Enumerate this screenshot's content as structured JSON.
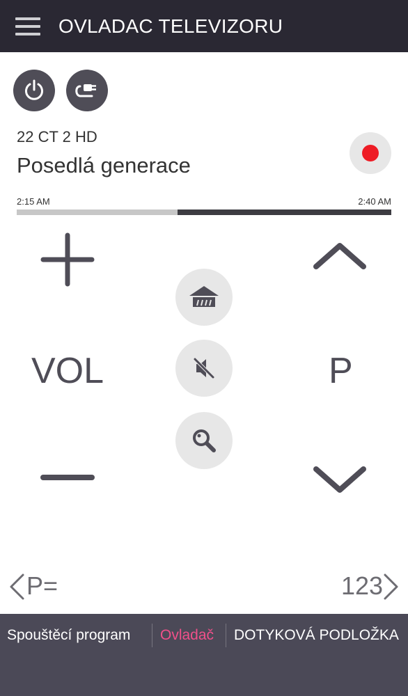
{
  "app_bar": {
    "title": "OVLADAC TELEVIZORU",
    "menu_icon": "hamburger-menu-icon"
  },
  "top_buttons": {
    "power_icon": "power-icon",
    "input_icon": "input-source-icon"
  },
  "program": {
    "channel": "22 CT 2 HD",
    "title": "Posedlá generace",
    "start_time": "2:15 AM",
    "end_time": "2:40 AM",
    "progress_percent": 43
  },
  "record_button": {
    "icon": "record-icon",
    "color": "#ee1c25"
  },
  "volume": {
    "label": "VOL",
    "up_icon": "plus-icon",
    "down_icon": "minus-icon"
  },
  "channel_control": {
    "label": "P",
    "up_icon": "chevron-up-icon",
    "down_icon": "chevron-down-icon"
  },
  "center_buttons": {
    "home_icon": "home-icon",
    "mute_icon": "mute-icon",
    "search_icon": "search-icon"
  },
  "nav": {
    "left_label": "P=",
    "right_label": "123",
    "left_icon": "chevron-left-icon",
    "right_icon": "chevron-right-icon"
  },
  "bottom_tabs": {
    "items": [
      {
        "label": "Spouštěcí program",
        "active": false
      },
      {
        "label": "Ovladač",
        "active": true
      },
      {
        "label": "DOTYKOVÁ PODLOŽKA",
        "active": false
      }
    ],
    "active_color": "#f0508a"
  },
  "colors": {
    "app_bar": "#2a2833",
    "bottom_bar": "#4b4957",
    "icon_dark": "#4f4d57",
    "button_light": "#e7e7e7"
  }
}
